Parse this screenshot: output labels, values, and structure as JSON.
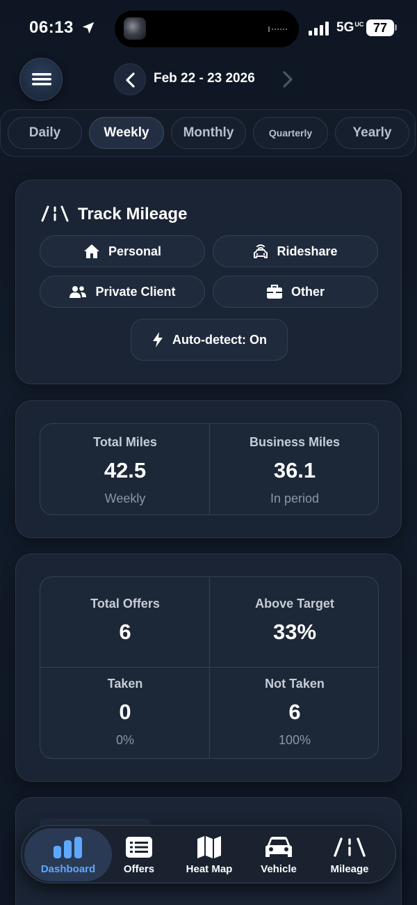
{
  "status_bar": {
    "time": "06:13",
    "network": "5G",
    "network_suffix": "UC",
    "battery": "77"
  },
  "header": {
    "date_range": "Feb 22 - 23 2026"
  },
  "period_tabs": [
    {
      "label": "Daily",
      "active": false
    },
    {
      "label": "Weekly",
      "active": true
    },
    {
      "label": "Monthly",
      "active": false
    },
    {
      "label": "Quarterly",
      "active": false
    },
    {
      "label": "Yearly",
      "active": false
    }
  ],
  "track_mileage": {
    "title": "Track Mileage",
    "options": [
      {
        "label": "Personal",
        "icon": "house-icon"
      },
      {
        "label": "Rideshare",
        "icon": "car-icon"
      },
      {
        "label": "Private Client",
        "icon": "users-icon"
      },
      {
        "label": "Other",
        "icon": "briefcase-icon"
      }
    ],
    "auto_detect": "Auto-detect: On"
  },
  "miles_stats": [
    {
      "label": "Total Miles",
      "value": "42.5",
      "sub": "Weekly"
    },
    {
      "label": "Business Miles",
      "value": "36.1",
      "sub": "In period"
    }
  ],
  "offer_stats": [
    {
      "label": "Total Offers",
      "value": "6",
      "sub": ""
    },
    {
      "label": "Above Target",
      "value": "33%",
      "sub": ""
    },
    {
      "label": "Taken",
      "value": "0",
      "sub": "0%"
    },
    {
      "label": "Not Taken",
      "value": "6",
      "sub": "100%"
    }
  ],
  "tabbar": [
    {
      "label": "Dashboard",
      "icon": "bar-chart-icon",
      "active": true
    },
    {
      "label": "Offers",
      "icon": "list-icon",
      "active": false
    },
    {
      "label": "Heat Map",
      "icon": "map-icon",
      "active": false
    },
    {
      "label": "Vehicle",
      "icon": "car-icon",
      "active": false
    },
    {
      "label": "Mileage",
      "icon": "road-icon",
      "active": false
    }
  ],
  "colors": {
    "background": "#0f1724",
    "card": "#1a2434",
    "accent": "#5ea8ff",
    "text": "#ffffff",
    "muted": "#8d96a5"
  }
}
